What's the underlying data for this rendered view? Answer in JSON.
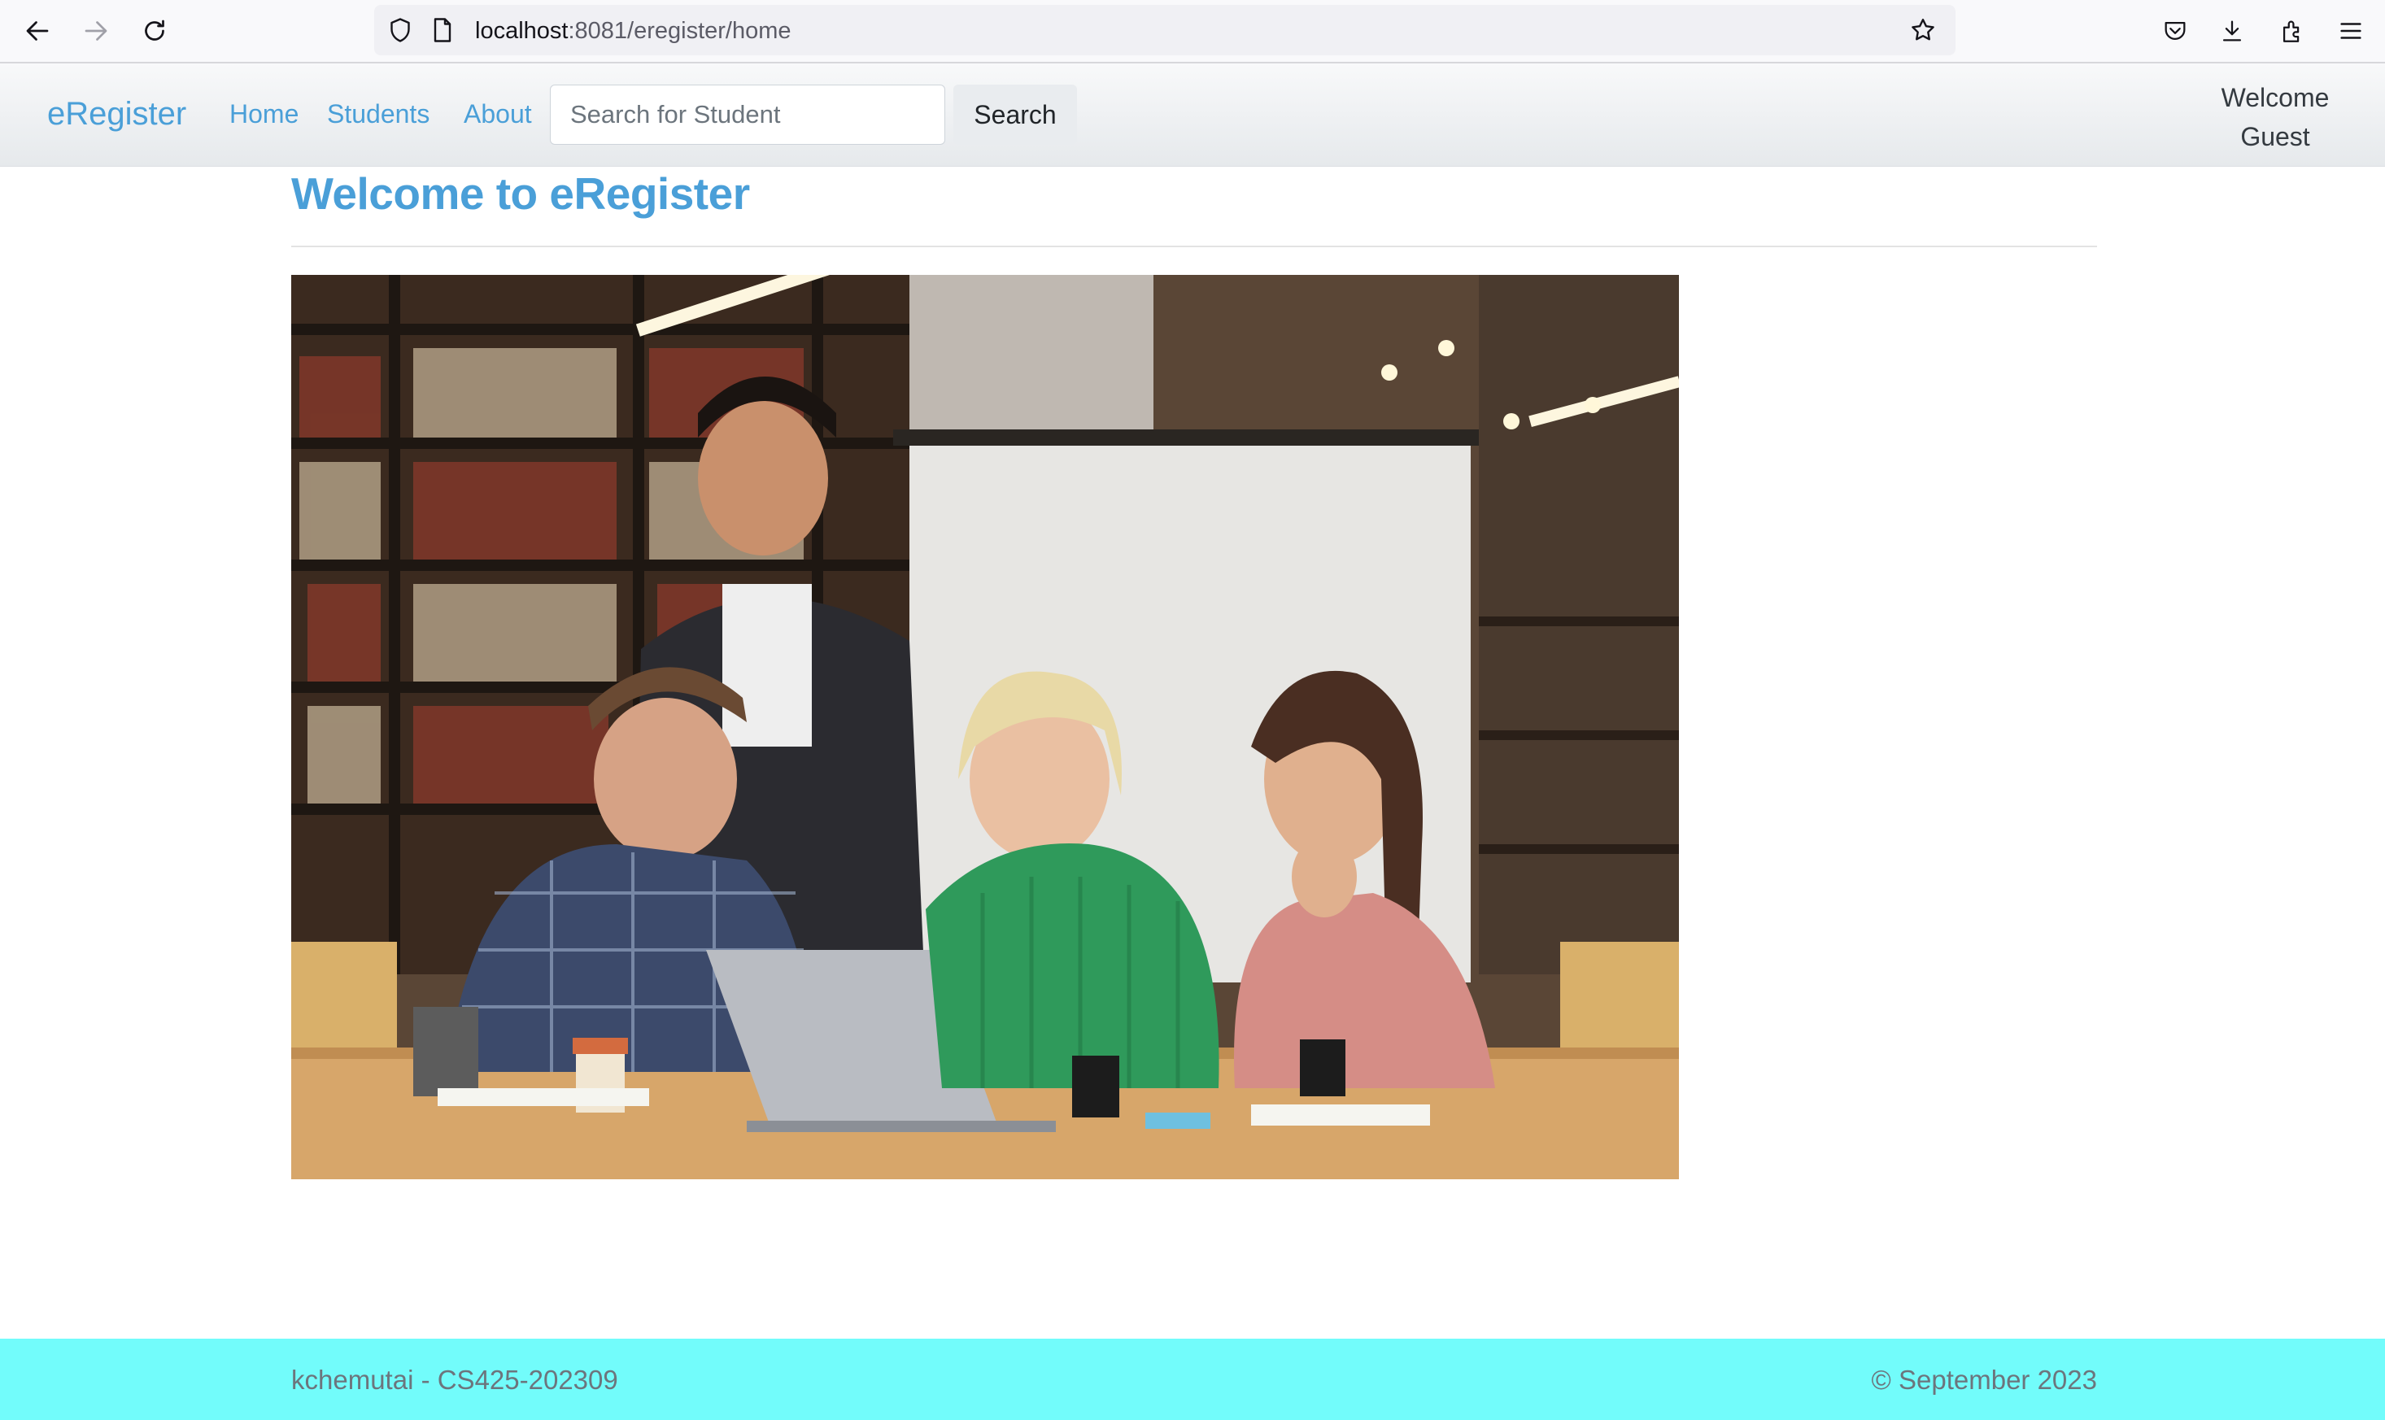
{
  "browser": {
    "url_host": "localhost",
    "url_path": ":8081/eregister/home",
    "icons": [
      "back-icon",
      "forward-icon",
      "reload-icon",
      "shield-icon",
      "page-icon",
      "bookmark-star-icon",
      "pocket-icon",
      "download-icon",
      "extensions-icon",
      "menu-icon"
    ]
  },
  "navbar": {
    "brand": "eRegister",
    "links": [
      "Home",
      "Students",
      "About"
    ],
    "search_placeholder": "Search for Student",
    "search_button": "Search",
    "welcome_line1": "Welcome",
    "welcome_line2": "Guest"
  },
  "main": {
    "title": "Welcome to eRegister"
  },
  "footer": {
    "left": "kchemutai - CS425-202309",
    "right": "© September 2023",
    "background": "#72fcfb"
  },
  "colors": {
    "accent": "#4a9fd8",
    "footer_text": "#6c757d"
  }
}
